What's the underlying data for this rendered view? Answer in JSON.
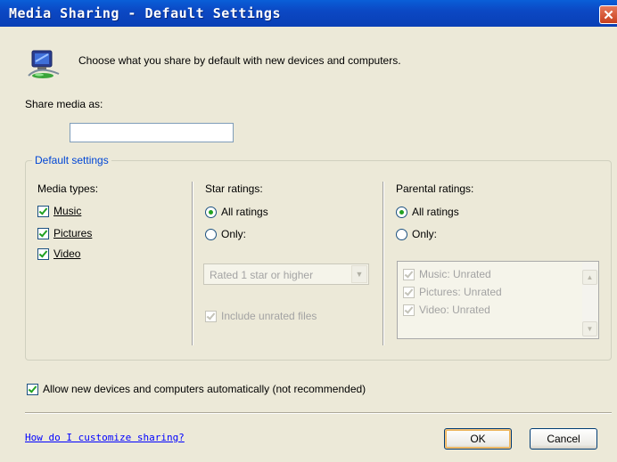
{
  "window": {
    "title": "Media Sharing - Default Settings",
    "close_glyph": "✕"
  },
  "intro_text": "Choose what you share by default with new devices and computers.",
  "share": {
    "label": "Share media as:",
    "value": ""
  },
  "default_settings": {
    "legend": "Default settings",
    "media_types": {
      "title": "Media types:",
      "items": [
        {
          "label": "Music",
          "checked": true
        },
        {
          "label": "Pictures",
          "checked": true
        },
        {
          "label": "Video",
          "checked": true
        }
      ]
    },
    "star_ratings": {
      "title": "Star ratings:",
      "all_label": "All ratings",
      "only_label": "Only:",
      "selected": "all",
      "combo_value": "Rated 1 star or higher",
      "include_unrated_label": "Include unrated files",
      "include_unrated_checked": true
    },
    "parental_ratings": {
      "title": "Parental ratings:",
      "all_label": "All ratings",
      "only_label": "Only:",
      "selected": "all",
      "list": [
        {
          "label": "Music: Unrated",
          "checked": true
        },
        {
          "label": "Pictures: Unrated",
          "checked": true
        },
        {
          "label": "Video: Unrated",
          "checked": true
        }
      ]
    }
  },
  "allow_new_devices": {
    "label": "Allow new devices and computers automatically (not recommended)",
    "checked": true
  },
  "help_link": "How do I customize sharing?",
  "buttons": {
    "ok": "OK",
    "cancel": "Cancel"
  },
  "icons": {
    "app_icon": "media-sharing-icon"
  },
  "colors": {
    "titlebar": "#0a4fc8",
    "link": "#0000ff",
    "group_legend": "#0046d5",
    "check": "#21a121"
  }
}
